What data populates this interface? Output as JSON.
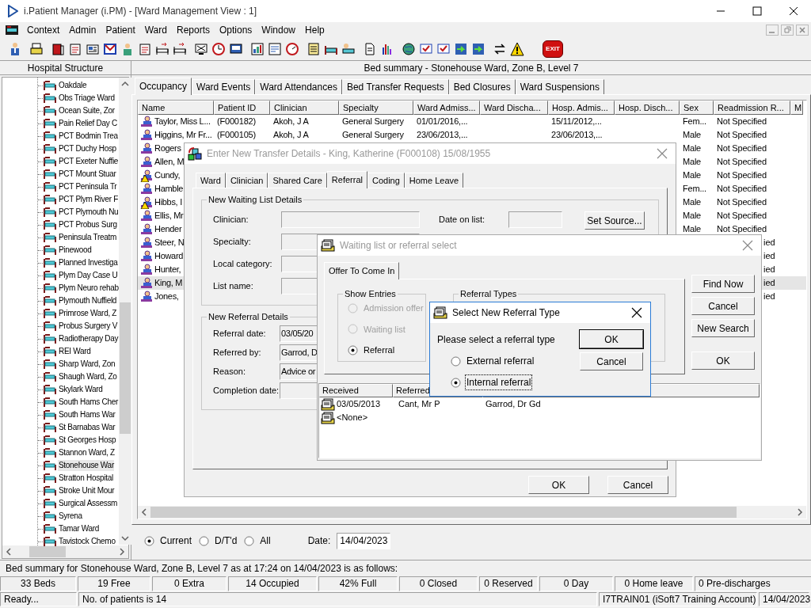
{
  "window": {
    "title": "i.Patient Manager (i.PM) - [Ward Management View : 1]"
  },
  "menu": [
    "Context",
    "Admin",
    "Patient",
    "Ward",
    "Reports",
    "Options",
    "Window",
    "Help"
  ],
  "toolbar": {
    "exit_label": "EXIT"
  },
  "sidebar": {
    "title": "Hospital Structure",
    "items": [
      {
        "label": "Oakdale",
        "selected": false
      },
      {
        "label": "Obs Triage Ward",
        "selected": false
      },
      {
        "label": "Ocean Suite, Zor",
        "selected": false
      },
      {
        "label": "Pain Relief Day C",
        "selected": false
      },
      {
        "label": "PCT Bodmin Trea",
        "selected": false
      },
      {
        "label": "PCT Duchy Hosp",
        "selected": false
      },
      {
        "label": "PCT Exeter Nuffie",
        "selected": false
      },
      {
        "label": "PCT Mount Stuar",
        "selected": false
      },
      {
        "label": "PCT Peninsula Tr",
        "selected": false
      },
      {
        "label": "PCT Plym River F",
        "selected": false
      },
      {
        "label": "PCT Plymouth Nu",
        "selected": false
      },
      {
        "label": "PCT Probus Surg",
        "selected": false
      },
      {
        "label": "Peninsula Treatm",
        "selected": false
      },
      {
        "label": "Pinewood",
        "selected": false
      },
      {
        "label": "Planned Investiga",
        "selected": false
      },
      {
        "label": "Plym Day Case U",
        "selected": false
      },
      {
        "label": "Plym Neuro rehab",
        "selected": false
      },
      {
        "label": "Plymouth Nuffield",
        "selected": false
      },
      {
        "label": "Primrose Ward, Z",
        "selected": false
      },
      {
        "label": "Probus Surgery V",
        "selected": false
      },
      {
        "label": "Radiotherapy Day",
        "selected": false
      },
      {
        "label": "REI Ward",
        "selected": false
      },
      {
        "label": "Sharp Ward, Zon",
        "selected": false
      },
      {
        "label": "Shaugh Ward, Zo",
        "selected": false
      },
      {
        "label": "Skylark Ward",
        "selected": false
      },
      {
        "label": "South Hams Cher",
        "selected": false
      },
      {
        "label": "South Hams War",
        "selected": false
      },
      {
        "label": "St Barnabas War",
        "selected": false
      },
      {
        "label": "St Georges Hosp",
        "selected": false
      },
      {
        "label": "Stannon Ward, Z",
        "selected": false
      },
      {
        "label": "Stonehouse War",
        "selected": true
      },
      {
        "label": "Stratton Hospital",
        "selected": false
      },
      {
        "label": "Stroke Unit Mour",
        "selected": false
      },
      {
        "label": "Surgical Assessm",
        "selected": false
      },
      {
        "label": "Syrena",
        "selected": false
      },
      {
        "label": "Tamar Ward",
        "selected": false
      },
      {
        "label": "Tavistock Chemo",
        "selected": false
      }
    ]
  },
  "main": {
    "title": "Bed summary - Stonehouse Ward, Zone B, Level 7",
    "tabs": [
      {
        "label": "Occupancy",
        "selected": true
      },
      {
        "label": "Ward Events",
        "selected": false
      },
      {
        "label": "Ward Attendances",
        "selected": false
      },
      {
        "label": "Bed Transfer Requests",
        "selected": false
      },
      {
        "label": "Bed Closures",
        "selected": false
      },
      {
        "label": "Ward Suspensions",
        "selected": false
      }
    ],
    "table": {
      "columns": [
        "Name",
        "Patient ID",
        "Clinician",
        "Specialty",
        "Ward Admiss...",
        "Ward Discha...",
        "Hosp. Admis...",
        "Hosp. Disch...",
        "Sex",
        "Readmission R...",
        "M"
      ],
      "rows": [
        {
          "name": "Taylor, Miss L...",
          "patient_id": "(F000182)",
          "clinician": "Akoh, J A",
          "specialty": "General Surgery",
          "ward_admission": "01/01/2016,...",
          "hosp_admission": "15/11/2012,...",
          "sex": "Fem...",
          "readmission": "Not Specified",
          "warning": false,
          "selected": false
        },
        {
          "name": "Higgins, Mr Fr...",
          "patient_id": "(F000105)",
          "clinician": "Akoh, J A",
          "specialty": "General Surgery",
          "ward_admission": "23/06/2013,...",
          "hosp_admission": "23/06/2013,...",
          "sex": "Male",
          "readmission": "Not Specified",
          "warning": false,
          "selected": false
        },
        {
          "name": "Rogers",
          "sex": "Male",
          "readmission": "Not Specified",
          "warning": false,
          "selected": false
        },
        {
          "name": "Allen, M",
          "sex": "Male",
          "readmission": "Not Specified",
          "warning": false,
          "selected": false
        },
        {
          "name": "Cundy,",
          "sex": "Male",
          "readmission": "Not Specified",
          "warning": true,
          "selected": false
        },
        {
          "name": "Hamble",
          "sex": "Fem...",
          "readmission": "Not Specified",
          "warning": false,
          "selected": false
        },
        {
          "name": "Hibbs, I",
          "sex": "Male",
          "readmission": "Not Specified",
          "warning": true,
          "selected": false
        },
        {
          "name": "Ellis, Mr",
          "sex": "Male",
          "readmission": "Not Specified",
          "warning": false,
          "selected": false
        },
        {
          "name": "Hender",
          "sex": "Male",
          "readmission": "Not Specified",
          "warning": false,
          "selected": false
        },
        {
          "name": "Steer, N",
          "readmission_tail": "ied",
          "warning": false,
          "selected": false
        },
        {
          "name": "Howard",
          "readmission_tail": "ied",
          "warning": false,
          "selected": false
        },
        {
          "name": "Hunter,",
          "readmission_tail": "ied",
          "warning": false,
          "selected": false
        },
        {
          "name": "King, M",
          "readmission_tail": "ied",
          "warning": false,
          "selected": true
        },
        {
          "name": "Jones,",
          "readmission_tail": "ied",
          "warning": false,
          "selected": false
        }
      ]
    },
    "filter": {
      "options": [
        {
          "label": "Current",
          "selected": true
        },
        {
          "label": "D/T'd",
          "selected": false
        },
        {
          "label": "All",
          "selected": false
        }
      ],
      "date_label": "Date:",
      "date": "14/04/2023"
    }
  },
  "summary_line": "Bed summary for Stonehouse Ward, Zone B, Level 7 as at 17:24 on 14/04/2023 is as follows:",
  "summary_cells": [
    "33 Beds",
    "19 Free",
    "0 Extra",
    "14 Occupied",
    "42% Full",
    "0 Closed",
    "0 Reserved",
    "0 Day",
    "0 Home leave",
    "0 Pre-discharges"
  ],
  "status_bar": [
    "Ready...",
    "No. of patients is 14",
    "I7TRAIN01 (iSoft7 Training Account)",
    "14/04/2023"
  ],
  "transfer_dialog": {
    "title": "Enter New Transfer Details - King, Katherine (F000108) 15/08/1955",
    "active": false,
    "tabs": [
      {
        "label": "Ward",
        "selected": false
      },
      {
        "label": "Clinician",
        "selected": false
      },
      {
        "label": "Shared Care",
        "selected": false
      },
      {
        "label": "Referral",
        "selected": true
      },
      {
        "label": "Coding",
        "selected": false
      },
      {
        "label": "Home Leave",
        "selected": false
      }
    ],
    "waiting_group": {
      "title": "New Waiting List Details",
      "fields": [
        {
          "label": "Clinician:"
        },
        {
          "label": "Specialty:"
        },
        {
          "label": "Local category:"
        },
        {
          "label": "List name:"
        }
      ],
      "date_label": "Date on list:",
      "source_button": "Set Source..."
    },
    "referral_group": {
      "title": "New Referral Details",
      "fields": [
        {
          "label": "Referral date:",
          "value": "03/05/20"
        },
        {
          "label": "Referred by:",
          "value": "Garrod, D"
        },
        {
          "label": "Reason:",
          "value": "Advice or"
        },
        {
          "label": "Completion date:"
        }
      ]
    },
    "buttons": [
      "OK",
      "Cancel"
    ]
  },
  "waiting_dialog": {
    "title": "Waiting list or referral select",
    "active": false,
    "tabs": [
      {
        "label": "Offer To Come In",
        "selected": true
      }
    ],
    "show_entries": {
      "title": "Show Entries",
      "options": [
        {
          "label": "Admission offer",
          "selected": false,
          "disabled": true
        },
        {
          "label": "Waiting list",
          "selected": false,
          "disabled": true
        },
        {
          "label": "Referral",
          "selected": true,
          "disabled": false
        }
      ]
    },
    "referral_types": {
      "title": "Referral Types"
    },
    "buttons": [
      "Find Now",
      "Cancel",
      "New Search"
    ],
    "ok_button": "OK",
    "list": {
      "columns": [
        "Received",
        "Referred"
      ],
      "rows": [
        {
          "received": "03/05/2013",
          "referred": "Cant, Mr P",
          "column_3": "Garrod, Dr Gd"
        },
        {
          "received": "<None>"
        }
      ]
    }
  },
  "referral_dialog": {
    "title": "Select New Referral Type",
    "active": true,
    "prompt": "Please select a referral type",
    "options": [
      {
        "label": "External referral",
        "selected": false
      },
      {
        "label": "Internal referral",
        "selected": true
      }
    ],
    "buttons": [
      "OK",
      "Cancel"
    ]
  }
}
